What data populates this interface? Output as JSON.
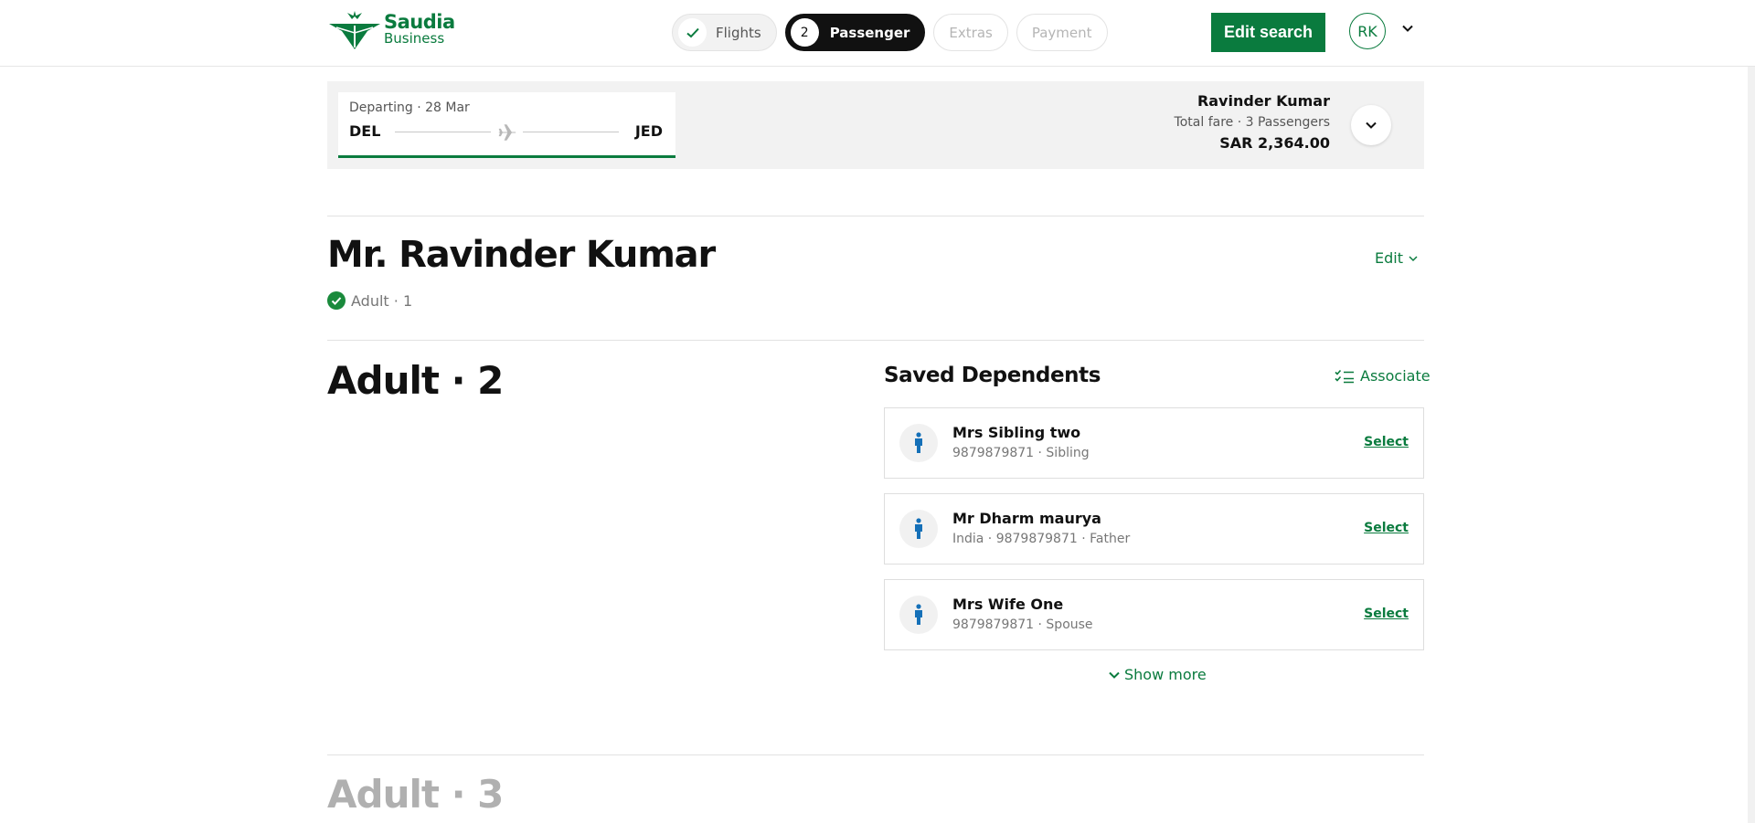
{
  "brand": {
    "name_line1": "Saudia",
    "name_line2": "Business",
    "color": "#0a7b3e"
  },
  "steps": [
    {
      "label": "Flights",
      "state": "done"
    },
    {
      "number": "2",
      "label": "Passenger",
      "state": "active"
    },
    {
      "label": "Extras",
      "state": "upcoming"
    },
    {
      "label": "Payment",
      "state": "upcoming"
    }
  ],
  "header": {
    "edit_search_label": "Edit search",
    "avatar_initials": "RK"
  },
  "trip": {
    "departing": "Departing · 28 Mar",
    "from": "DEL",
    "to": "JED",
    "passenger_name": "Ravinder Kumar",
    "fare_label": "Total fare · 3 Passengers",
    "total": "SAR 2,364.00"
  },
  "passenger1": {
    "title": "Mr. Ravinder Kumar",
    "status": "Adult · 1",
    "edit_label": "Edit"
  },
  "passenger2": {
    "title": "Adult · 2"
  },
  "passenger3": {
    "title": "Adult · 3"
  },
  "dependents": {
    "title": "Saved Dependents",
    "associate_label": "Associate",
    "select_label": "Select",
    "show_more_label": "Show more",
    "items": [
      {
        "name": "Mrs Sibling two",
        "meta": "9879879871 ·  Sibling"
      },
      {
        "name": "Mr Dharm maurya",
        "meta": "India  ·  9879879871 ·  Father"
      },
      {
        "name": "Mrs Wife One",
        "meta": "9879879871 ·  Spouse"
      }
    ]
  }
}
